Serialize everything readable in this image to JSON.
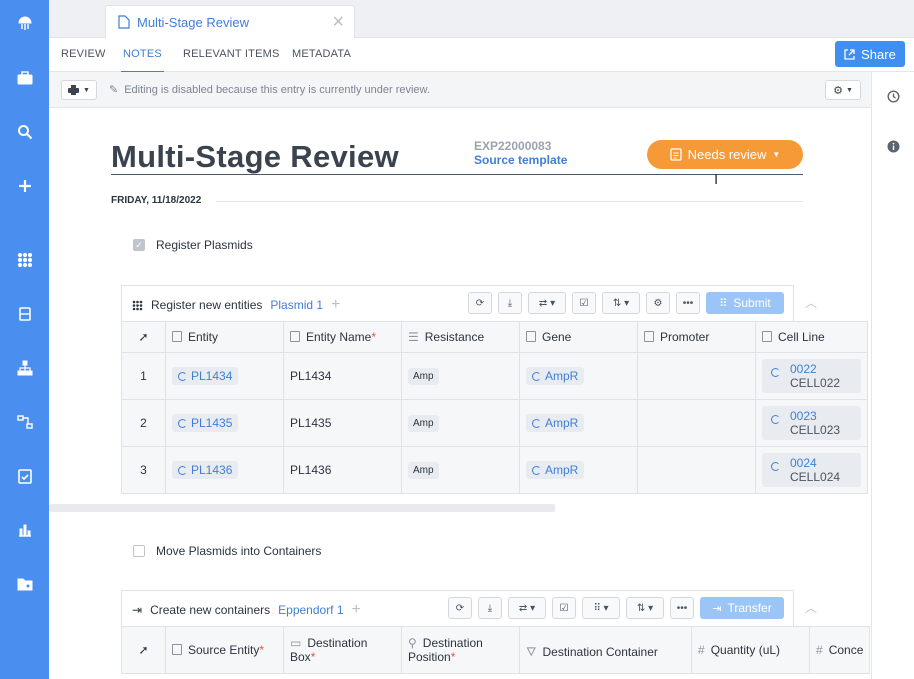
{
  "doc_tab": {
    "title": "Multi-Stage Review"
  },
  "tabs": [
    {
      "label": "REVIEW"
    },
    {
      "label": "NOTES"
    },
    {
      "label": "RELEVANT ITEMS"
    },
    {
      "label": "METADATA"
    }
  ],
  "share_label": "Share",
  "toolbar": {
    "disabled_message": "Editing is disabled because this entry is currently under review."
  },
  "entry": {
    "title": "Multi-Stage Review",
    "id": "EXP22000083",
    "source_template": "Source template",
    "status": "Needs review",
    "date": "FRIDAY, 11/18/2022"
  },
  "tasks": [
    {
      "label": "Register Plasmids",
      "checked": true
    },
    {
      "label": "Move Plasmids into Containers",
      "checked": false
    }
  ],
  "register_panel": {
    "title": "Register new entities",
    "schema": "Plasmid 1",
    "action": "Submit",
    "columns": [
      "Entity",
      "Entity Name",
      "Resistance",
      "Gene",
      "Promoter",
      "Cell Line"
    ],
    "rows": [
      {
        "n": "1",
        "entity": "PL1434",
        "name": "PL1434",
        "resistance": "Amp",
        "gene": "AmpR",
        "promoter": "",
        "cell_a": "0022",
        "cell_b": "CELL022"
      },
      {
        "n": "2",
        "entity": "PL1435",
        "name": "PL1435",
        "resistance": "Amp",
        "gene": "AmpR",
        "promoter": "",
        "cell_a": "0023",
        "cell_b": "CELL023"
      },
      {
        "n": "3",
        "entity": "PL1436",
        "name": "PL1436",
        "resistance": "Amp",
        "gene": "AmpR",
        "promoter": "",
        "cell_a": "0024",
        "cell_b": "CELL024"
      }
    ]
  },
  "container_panel": {
    "title": "Create new containers",
    "schema": "Eppendorf 1",
    "action": "Transfer",
    "columns": [
      "Source Entity",
      "Destination Box",
      "Destination Position",
      "Destination Container",
      "Quantity (uL)",
      "Conce"
    ]
  },
  "colors": {
    "nav": "#4a8ff0",
    "accent": "#3f7fd6",
    "status": "#f69a37"
  }
}
